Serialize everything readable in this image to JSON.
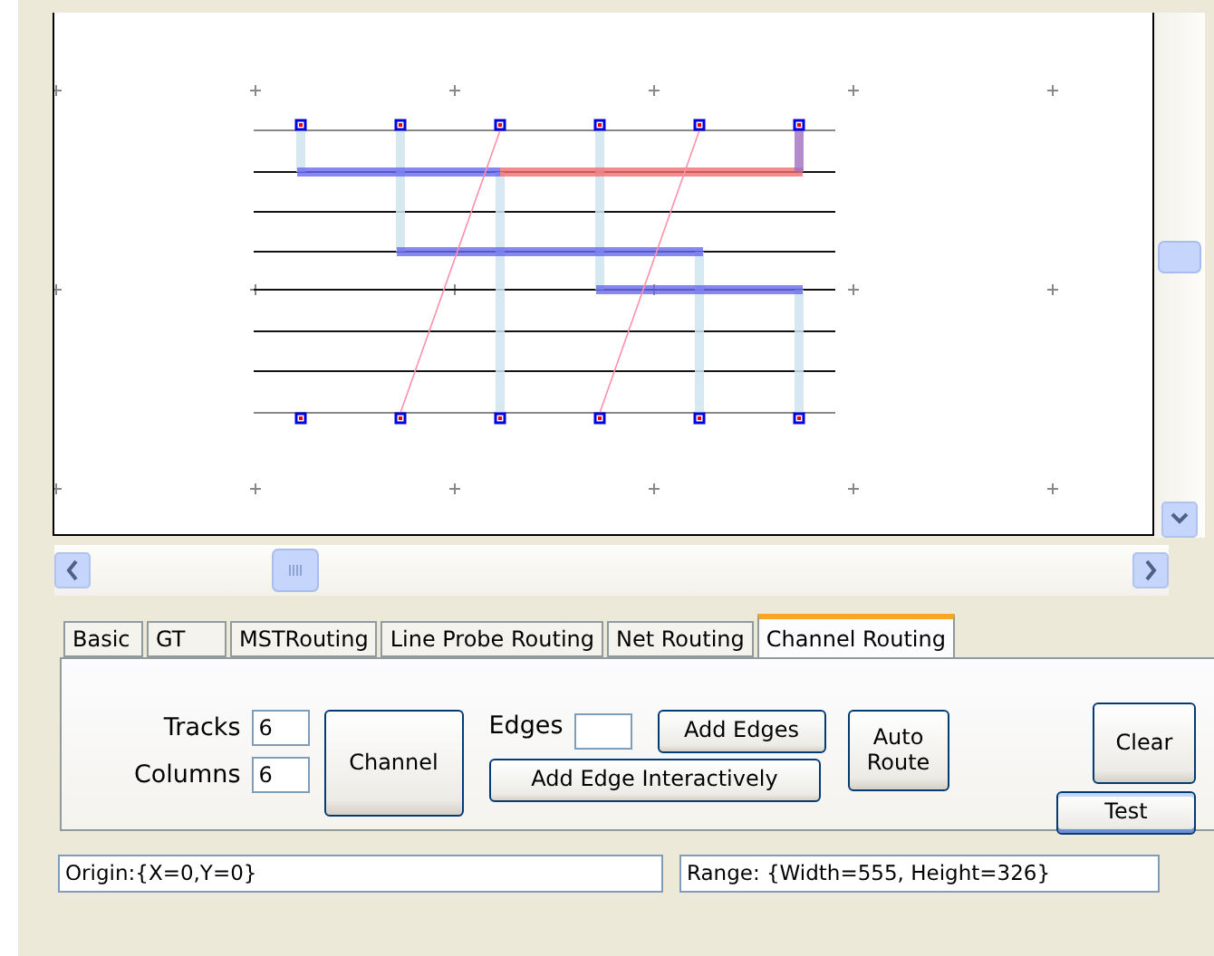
{
  "tabs": [
    {
      "label": "Basic",
      "selected": false
    },
    {
      "label": "GT",
      "selected": false
    },
    {
      "label": "MSTRouting",
      "selected": false
    },
    {
      "label": "Line Probe Routing",
      "selected": false
    },
    {
      "label": "Net Routing",
      "selected": false
    },
    {
      "label": "Channel Routing",
      "selected": true
    }
  ],
  "panel": {
    "tracks_label": "Tracks",
    "tracks_value": "6",
    "columns_label": "Columns",
    "columns_value": "6",
    "edges_label": "Edges",
    "buttons": {
      "channel": "Channel",
      "add_edges": "Add Edges",
      "add_edge_interactively": "Add Edge Interactively",
      "auto_route": "Auto Route",
      "clear": "Clear",
      "test": "Test"
    }
  },
  "status_bar": {
    "origin": "Origin:{X=0,Y=0}",
    "range": "Range: {Width=555, Height=326}"
  }
}
